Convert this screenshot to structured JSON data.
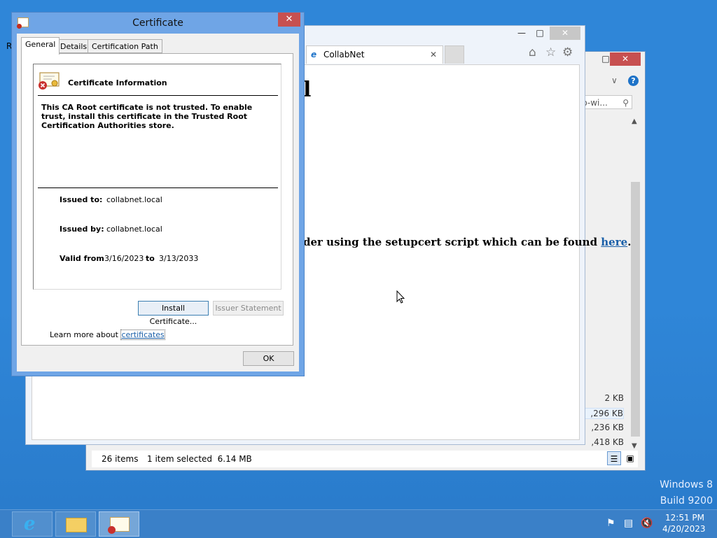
{
  "desktop": {
    "watermark_line1": "Windows 8",
    "watermark_line2": "Build 9200",
    "edge_label": "R"
  },
  "explorer": {
    "search_placeholder": "io-wi...",
    "sizes": [
      "2 KB",
      ",296 KB",
      ",236 KB",
      ",418 KB"
    ],
    "status_items": "26 items",
    "status_selected": "1 item selected  6.14 MB"
  },
  "ie": {
    "tab_title": "CollabNet",
    "big_text": "l",
    "body_text": "der using the setupcert script which can be found ",
    "body_link": "here",
    "body_suffix": "."
  },
  "certificate": {
    "title": "Certificate",
    "tabs": [
      "General",
      "Details",
      "Certification Path"
    ],
    "info_heading": "Certificate Information",
    "warning": "This CA Root certificate is not trusted. To enable trust, install this certificate in the Trusted Root Certification Authorities store.",
    "issued_to_label": "Issued to:",
    "issued_to_value": "collabnet.local",
    "issued_by_label": "Issued by:",
    "issued_by_value": "collabnet.local",
    "valid_from_label": "Valid from",
    "valid_from_value": "3/16/2023",
    "valid_to_label": "to",
    "valid_to_value": "3/13/2033",
    "install_button": "Install Certificate...",
    "issuer_statement_button": "Issuer Statement",
    "learn_more_text": "Learn more about ",
    "learn_more_link": "certificates",
    "ok_button": "OK"
  },
  "taskbar": {
    "time": "12:51 PM",
    "date": "4/20/2023"
  },
  "colors": {
    "desktop": "#2f86d8",
    "dialog_frame": "#6fa5e6",
    "close_button": "#c75050",
    "link": "#1a5fa8"
  }
}
